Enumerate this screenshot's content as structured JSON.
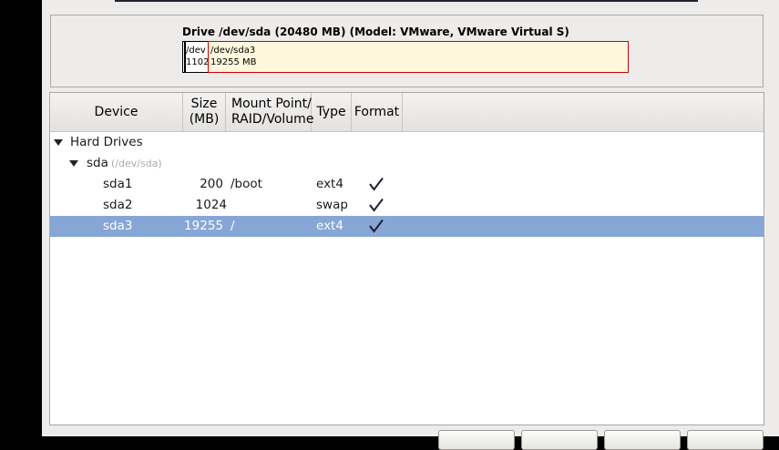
{
  "drive": {
    "label": "Drive /dev/sda (20480 MB) (Model: VMware, VMware Virtual S)",
    "segments": [
      {
        "name": "",
        "size": ""
      },
      {
        "name": "/dev",
        "size": "1102"
      },
      {
        "name": "/dev/sda3",
        "size": "19255 MB"
      }
    ]
  },
  "table": {
    "columns": {
      "device": "Device",
      "size": "Size\n(MB)",
      "mount": "Mount Point/\nRAID/Volume",
      "type": "Type",
      "format": "Format"
    },
    "group": "Hard Drives",
    "disk": {
      "name": "sda",
      "path": "(/dev/sda)"
    },
    "rows": [
      {
        "device": "sda1",
        "size": "200",
        "mount": "/boot",
        "type": "ext4",
        "format": true
      },
      {
        "device": "sda2",
        "size": "1024",
        "mount": "",
        "type": "swap",
        "format": true
      },
      {
        "device": "sda3",
        "size": "19255",
        "mount": "/",
        "type": "ext4",
        "format": true,
        "selected": true
      }
    ]
  },
  "icons": {
    "expand": "triangle-down-icon",
    "format": "checkmark-icon"
  },
  "colors": {
    "selection": "#86a6d6",
    "sda3_bar_border": "#cc0000",
    "sda3_bar_fill": "#fff8de"
  }
}
